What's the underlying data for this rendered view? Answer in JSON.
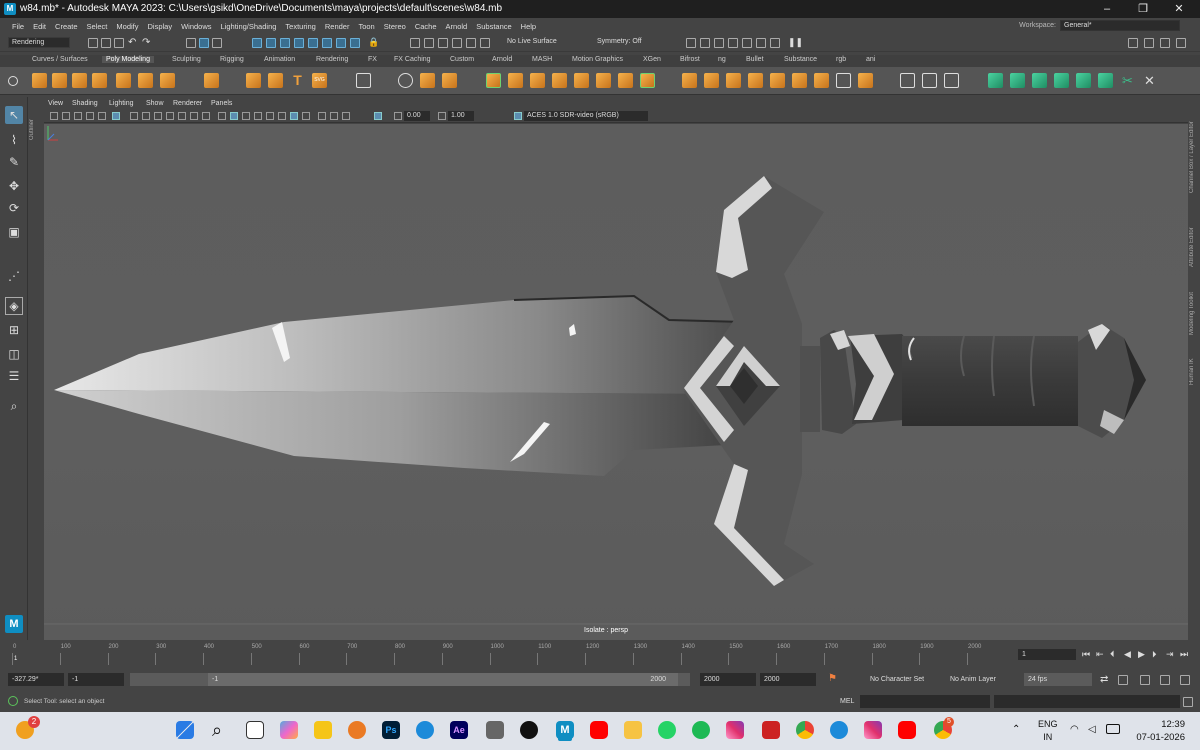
{
  "window": {
    "title": "w84.mb* - Autodesk MAYA 2023: C:\\Users\\gsikd\\OneDrive\\Documents\\maya\\projects\\default\\scenes\\w84.mb",
    "logo": "M",
    "minimize": "–",
    "maximize": "❐",
    "close": "✕"
  },
  "menubar": {
    "items": [
      "File",
      "Edit",
      "Create",
      "Select",
      "Modify",
      "Display",
      "Windows",
      "Lighting/Shading",
      "Texturing",
      "Render",
      "Toon",
      "Stereo",
      "Cache",
      "Arnold",
      "Substance",
      "Help"
    ],
    "workspace_label": "Workspace:",
    "workspace_value": "General*"
  },
  "statusline": {
    "menuset": "Rendering",
    "live_surface": "No Live Surface",
    "symmetry": "Symmetry: Off"
  },
  "shelf": {
    "tabs": [
      "Curves / Surfaces",
      "Poly Modeling",
      "Sculpting",
      "Rigging",
      "Animation",
      "Rendering",
      "FX",
      "FX Caching",
      "Custom",
      "Arnold",
      "MASH",
      "Motion Graphics",
      "XGen",
      "Bifrost",
      "ng",
      "Bullet",
      "Substance",
      "rgb",
      "ani"
    ],
    "active_tab": "Poly Modeling"
  },
  "outliner_label": "Outliner",
  "panel": {
    "menus": [
      "View",
      "Shading",
      "Lighting",
      "Show",
      "Renderer",
      "Panels"
    ],
    "exposure": "0.00",
    "gamma": "1.00",
    "colorspace": "ACES 1.0 SDR-video (sRGB)"
  },
  "viewport": {
    "label": "Isolate : persp"
  },
  "rightbar": {
    "labels": [
      "Channel Box / Layer Editor",
      "Attribute Editor",
      "Modeling Toolkit",
      "Human IK"
    ]
  },
  "timeline": {
    "ticks": [
      "0",
      "100",
      "200",
      "300",
      "400",
      "500",
      "600",
      "700",
      "800",
      "900",
      "1000",
      "1100",
      "1200",
      "1300",
      "1400",
      "1500",
      "1600",
      "1700",
      "1800",
      "1900",
      "2000"
    ],
    "current_frame": "1",
    "current_frame_field": "1"
  },
  "range": {
    "coord": "-327.29*",
    "start": "-1",
    "slider_start": "-1",
    "slider_end": "2000",
    "end": "2000",
    "end2": "2000",
    "character_set": "No Character Set",
    "anim_layer": "No Anim Layer",
    "fps": "24 fps"
  },
  "cmdline": {
    "lang": "MEL",
    "help": "Select Tool: select an object"
  },
  "taskbar": {
    "lang1": "ENG",
    "lang2": "IN",
    "time": "12:39",
    "date": "07-01-2026",
    "badge1": "2",
    "badge2": "5",
    "ps_label": "Ps",
    "ae_label": "Ae"
  },
  "colors": {
    "accent": "#5285a6",
    "viewport_bg": "#5d5d5d",
    "shelf_orange": "#f0a03c",
    "shelf_green": "#3cc08c"
  }
}
